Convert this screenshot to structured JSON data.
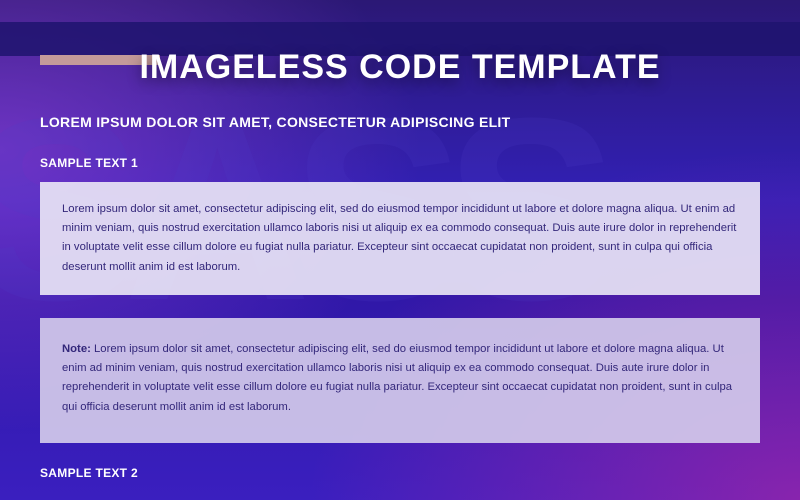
{
  "ghost_text": "SASS",
  "title": "IMAGELESS CODE TEMPLATE",
  "subtitle": "LOREM IPSUM DOLOR SIT AMET, CONSECTETUR ADIPISCING ELIT",
  "section1_heading": "SAMPLE TEXT 1",
  "paragraph1": "Lorem ipsum dolor sit amet, consectetur adipiscing elit, sed do eiusmod tempor incididunt ut labore et dolore magna aliqua. Ut enim ad minim veniam, quis nostrud exercitation ullamco laboris nisi ut aliquip ex ea commodo consequat. Duis aute irure dolor in reprehenderit in voluptate velit esse cillum dolore eu fugiat nulla pariatur. Excepteur sint occaecat cupidatat non proident, sunt in culpa qui officia deserunt mollit anim id est laborum.",
  "note_label": "Note:",
  "note_body": " Lorem ipsum dolor sit amet, consectetur adipiscing elit, sed do eiusmod tempor incididunt ut labore et dolore magna aliqua. Ut enim ad minim veniam, quis nostrud exercitation ullamco laboris nisi ut aliquip ex ea commodo consequat. Duis aute irure dolor in reprehenderit in voluptate velit esse cillum dolore eu fugiat nulla pariatur. Excepteur sint occaecat cupidatat non proident, sunt in culpa qui officia deserunt mollit anim id est laborum.",
  "section2_heading": "SAMPLE TEXT 2"
}
